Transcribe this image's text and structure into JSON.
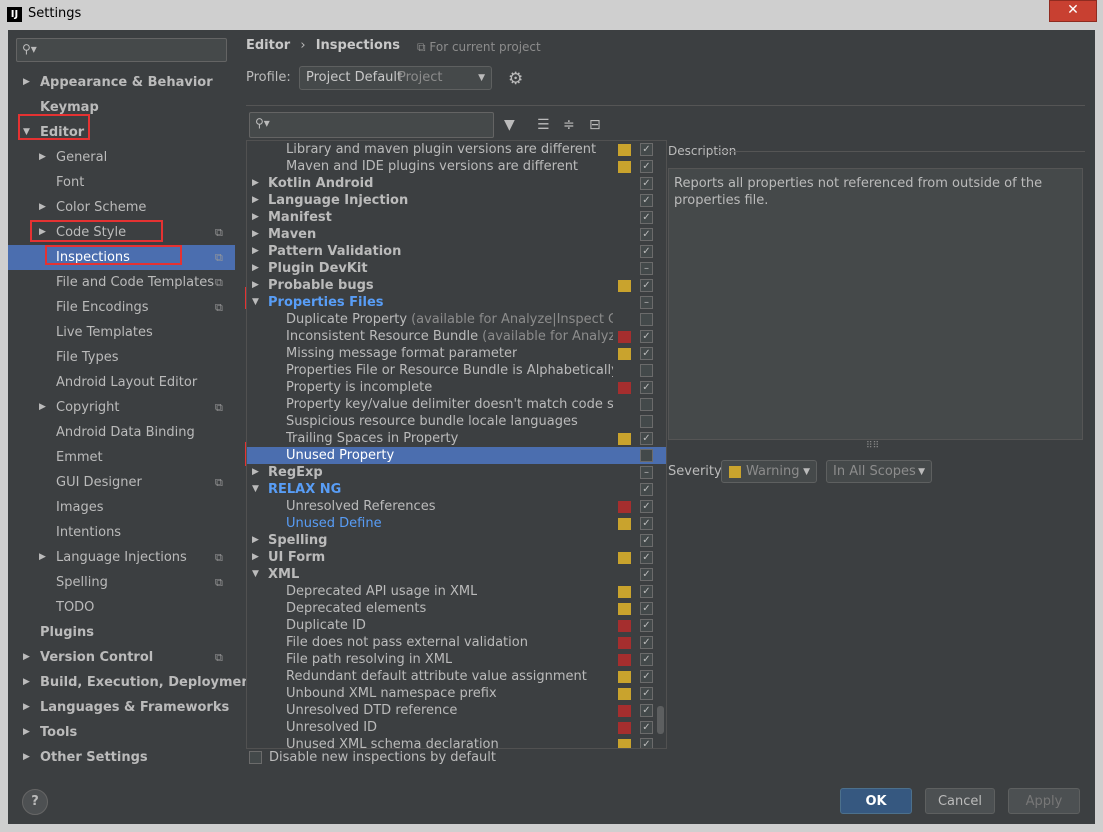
{
  "window": {
    "title": "Settings",
    "app_icon": "intellij-icon"
  },
  "sidebar": {
    "search_placeholder": "",
    "items": [
      {
        "label": "Appearance & Behavior",
        "bold": true,
        "arrow": "right",
        "indent": 0
      },
      {
        "label": "Keymap",
        "bold": true,
        "arrow": "",
        "indent": 0
      },
      {
        "label": "Editor",
        "bold": true,
        "arrow": "down",
        "indent": 0
      },
      {
        "label": "General",
        "bold": false,
        "arrow": "right",
        "indent": 1
      },
      {
        "label": "Font",
        "bold": false,
        "arrow": "",
        "indent": 1
      },
      {
        "label": "Color Scheme",
        "bold": false,
        "arrow": "right",
        "indent": 1
      },
      {
        "label": "Code Style",
        "bold": false,
        "arrow": "right",
        "indent": 1,
        "copy": true
      },
      {
        "label": "Inspections",
        "bold": false,
        "arrow": "",
        "indent": 1,
        "copy": true,
        "selected": true
      },
      {
        "label": "File and Code Templates",
        "bold": false,
        "arrow": "",
        "indent": 1,
        "copy": true
      },
      {
        "label": "File Encodings",
        "bold": false,
        "arrow": "",
        "indent": 1,
        "copy": true
      },
      {
        "label": "Live Templates",
        "bold": false,
        "arrow": "",
        "indent": 1
      },
      {
        "label": "File Types",
        "bold": false,
        "arrow": "",
        "indent": 1
      },
      {
        "label": "Android Layout Editor",
        "bold": false,
        "arrow": "",
        "indent": 1
      },
      {
        "label": "Copyright",
        "bold": false,
        "arrow": "right",
        "indent": 1,
        "copy": true
      },
      {
        "label": "Android Data Binding",
        "bold": false,
        "arrow": "",
        "indent": 1
      },
      {
        "label": "Emmet",
        "bold": false,
        "arrow": "",
        "indent": 1
      },
      {
        "label": "GUI Designer",
        "bold": false,
        "arrow": "",
        "indent": 1,
        "copy": true
      },
      {
        "label": "Images",
        "bold": false,
        "arrow": "",
        "indent": 1
      },
      {
        "label": "Intentions",
        "bold": false,
        "arrow": "",
        "indent": 1
      },
      {
        "label": "Language Injections",
        "bold": false,
        "arrow": "right",
        "indent": 1,
        "copy": true
      },
      {
        "label": "Spelling",
        "bold": false,
        "arrow": "",
        "indent": 1,
        "copy": true
      },
      {
        "label": "TODO",
        "bold": false,
        "arrow": "",
        "indent": 1
      },
      {
        "label": "Plugins",
        "bold": true,
        "arrow": "",
        "indent": 0
      },
      {
        "label": "Version Control",
        "bold": true,
        "arrow": "right",
        "indent": 0,
        "copy": true
      },
      {
        "label": "Build, Execution, Deployment",
        "bold": true,
        "arrow": "right",
        "indent": 0
      },
      {
        "label": "Languages & Frameworks",
        "bold": true,
        "arrow": "right",
        "indent": 0
      },
      {
        "label": "Tools",
        "bold": true,
        "arrow": "right",
        "indent": 0
      },
      {
        "label": "Other Settings",
        "bold": true,
        "arrow": "right",
        "indent": 0
      }
    ]
  },
  "header": {
    "crumb1": "Editor",
    "crumb_sep": "›",
    "crumb2": "Inspections",
    "for_project": "For current project",
    "profile_label": "Profile:",
    "profile_value": "Project Default",
    "profile_hint": "Project"
  },
  "inspections": {
    "rows": [
      {
        "label": "Library and maven plugin versions are different",
        "level": 2,
        "sev": "warning",
        "check": "checked"
      },
      {
        "label": "Maven and IDE plugins versions are different",
        "level": 2,
        "sev": "warning",
        "check": "checked"
      },
      {
        "label": "Kotlin Android",
        "level": 1,
        "arrow": "right",
        "check": "checked"
      },
      {
        "label": "Language Injection",
        "level": 1,
        "arrow": "right",
        "check": "checked"
      },
      {
        "label": "Manifest",
        "level": 1,
        "arrow": "right",
        "check": "checked"
      },
      {
        "label": "Maven",
        "level": 1,
        "arrow": "right",
        "check": "checked"
      },
      {
        "label": "Pattern Validation",
        "level": 1,
        "arrow": "right",
        "check": "checked"
      },
      {
        "label": "Plugin DevKit",
        "level": 1,
        "arrow": "right",
        "check": "mixed"
      },
      {
        "label": "Probable bugs",
        "level": 1,
        "arrow": "right",
        "sev": "warning",
        "check": "checked"
      },
      {
        "label": "Properties Files",
        "level": 1,
        "arrow": "down",
        "link": true,
        "check": "mixed"
      },
      {
        "label": "Duplicate Property",
        "hint": "(available for Analyze|Inspect Code)",
        "level": 2,
        "check": "unchecked"
      },
      {
        "label": "Inconsistent Resource Bundle",
        "hint": "(available for Analyze|Insp",
        "level": 2,
        "sev": "error",
        "check": "checked"
      },
      {
        "label": "Missing message format parameter",
        "level": 2,
        "sev": "warning",
        "check": "checked"
      },
      {
        "label": "Properties File or Resource Bundle is Alphabetically Unso",
        "level": 2,
        "check": "unchecked"
      },
      {
        "label": "Property is incomplete",
        "level": 2,
        "sev": "error",
        "check": "checked"
      },
      {
        "label": "Property key/value delimiter doesn't match code style settings",
        "level": 2,
        "check": "unchecked"
      },
      {
        "label": "Suspicious resource bundle locale languages",
        "level": 2,
        "check": "unchecked"
      },
      {
        "label": "Trailing Spaces in Property",
        "level": 2,
        "sev": "warning",
        "check": "checked"
      },
      {
        "label": "Unused Property",
        "level": 2,
        "check": "unchecked",
        "selected": true
      },
      {
        "label": "RegExp",
        "level": 1,
        "arrow": "right",
        "check": "mixed"
      },
      {
        "label": "RELAX NG",
        "level": 1,
        "arrow": "down",
        "link": true,
        "check": "checked"
      },
      {
        "label": "Unresolved References",
        "level": 2,
        "sev": "error",
        "check": "checked"
      },
      {
        "label": "Unused Define",
        "level": 2,
        "link": true,
        "sev": "warning",
        "check": "checked"
      },
      {
        "label": "Spelling",
        "level": 1,
        "arrow": "right",
        "check": "checked"
      },
      {
        "label": "UI Form",
        "level": 1,
        "arrow": "right",
        "sev": "warning",
        "check": "checked"
      },
      {
        "label": "XML",
        "level": 1,
        "arrow": "down",
        "check": "checked"
      },
      {
        "label": "Deprecated API usage in XML",
        "level": 2,
        "sev": "warning",
        "check": "checked"
      },
      {
        "label": "Deprecated elements",
        "level": 2,
        "sev": "warning",
        "check": "checked"
      },
      {
        "label": "Duplicate ID",
        "level": 2,
        "sev": "error",
        "check": "checked"
      },
      {
        "label": "File does not pass external validation",
        "level": 2,
        "sev": "error",
        "check": "checked"
      },
      {
        "label": "File path resolving in XML",
        "level": 2,
        "sev": "error",
        "check": "checked"
      },
      {
        "label": "Redundant default attribute value assignment",
        "level": 2,
        "sev": "warning",
        "check": "checked"
      },
      {
        "label": "Unbound XML namespace prefix",
        "level": 2,
        "sev": "warning",
        "check": "checked"
      },
      {
        "label": "Unresolved DTD reference",
        "level": 2,
        "sev": "error",
        "check": "checked"
      },
      {
        "label": "Unresolved ID",
        "level": 2,
        "sev": "error",
        "check": "checked"
      },
      {
        "label": "Unused XML schema declaration",
        "level": 2,
        "sev": "warning",
        "check": "checked"
      }
    ]
  },
  "description": {
    "label": "Description",
    "text": "Reports all properties not referenced from outside of the properties file."
  },
  "severity": {
    "label": "Severity:",
    "value": "Warning",
    "scope": "In All Scopes"
  },
  "footer": {
    "disable_new_label": "Disable new inspections by default",
    "help": "?",
    "ok": "OK",
    "cancel": "Cancel",
    "apply": "Apply"
  },
  "colors": {
    "warning": "#c9a32d",
    "error": "#a52e2e",
    "selection": "#4b6eaf",
    "link": "#589df6",
    "highlight_box": "#e53232"
  }
}
